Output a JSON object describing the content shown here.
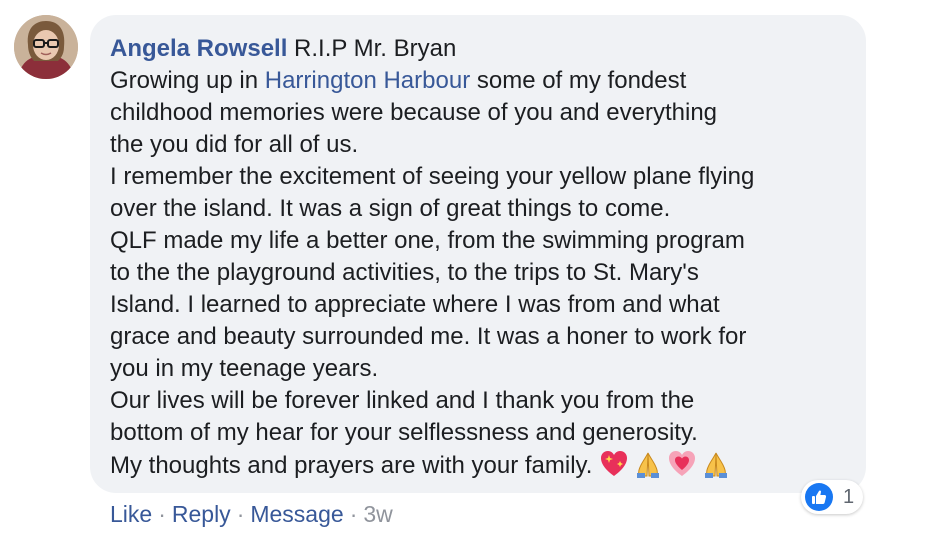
{
  "comment": {
    "author": "Angela Rowsell",
    "first_line_text": " R.I.P Mr. Bryan",
    "lines": [
      {
        "before": "Growing up in ",
        "link": "Harrington Harbour",
        "after": " some of my fondest"
      },
      {
        "text": "childhood memories were because of you and everything"
      },
      {
        "text": "the you did for all of us."
      },
      {
        "text": "I remember the excitement of seeing your yellow plane flying"
      },
      {
        "text": "over the island. It was a sign of great things to come."
      },
      {
        "text": "QLF made my life a better one, from the swimming program"
      },
      {
        "text": "to the the playground activities, to the trips to St. Mary's"
      },
      {
        "text": "Island. I learned to appreciate where I was from and what"
      },
      {
        "text": "grace and beauty surrounded me. It was a honer to work for"
      },
      {
        "text": "you in my teenage years."
      },
      {
        "text": "Our lives will be forever linked and I thank you from the"
      },
      {
        "text": "bottom of my hear for your selflessness and generosity."
      },
      {
        "text": "My thoughts and prayers are with your family. "
      }
    ],
    "emojis": [
      "sparkling-heart-icon",
      "folded-hands-icon",
      "growing-heart-icon",
      "folded-hands-icon"
    ]
  },
  "reactions": {
    "icon": "like-icon",
    "count": "1"
  },
  "actions": {
    "like": "Like",
    "reply": "Reply",
    "message": "Message",
    "separator": "·",
    "timestamp": "3w"
  },
  "colors": {
    "bubble": "#f0f2f5",
    "link": "#385898",
    "text": "#1c1e21",
    "meta": "#90949c",
    "like_blue": "#1877f2"
  }
}
